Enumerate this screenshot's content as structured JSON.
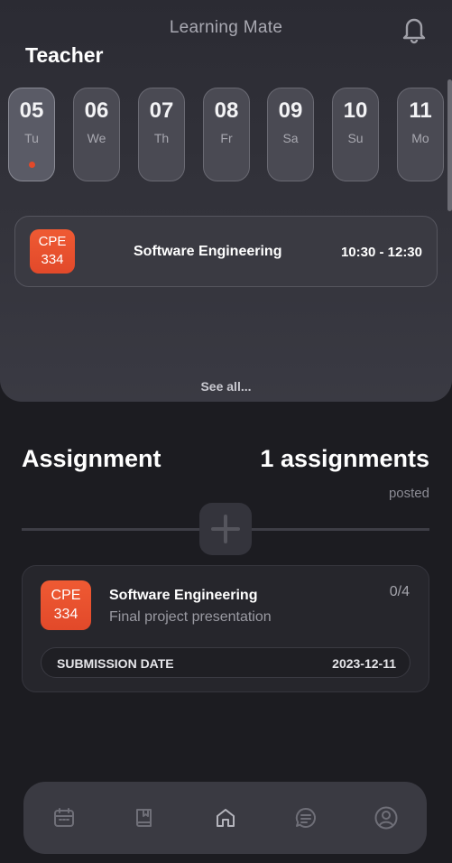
{
  "app": {
    "title": "Learning Mate",
    "role": "Teacher"
  },
  "calendar": {
    "days": [
      {
        "num": "05",
        "name": "Tu",
        "active": true
      },
      {
        "num": "06",
        "name": "We"
      },
      {
        "num": "07",
        "name": "Th"
      },
      {
        "num": "08",
        "name": "Fr"
      },
      {
        "num": "09",
        "name": "Sa"
      },
      {
        "num": "10",
        "name": "Su"
      },
      {
        "num": "11",
        "name": "Mo"
      }
    ]
  },
  "schedule": {
    "items": [
      {
        "code_line1": "CPE",
        "code_line2": "334",
        "course": "Software Engineering",
        "time": "10:30 - 12:30"
      }
    ],
    "see_all": "See all..."
  },
  "assignments": {
    "title": "Assignment",
    "count": "1 assignments",
    "posted": "posted",
    "items": [
      {
        "code_line1": "CPE",
        "code_line2": "334",
        "course": "Software Engineering",
        "description": "Final project presentation",
        "progress": "0/4",
        "submission_label": "SUBMISSION DATE",
        "submission_date": "2023-12-11"
      }
    ]
  },
  "nav": {
    "items": [
      {
        "icon": "calendar-icon"
      },
      {
        "icon": "book-icon"
      },
      {
        "icon": "home-icon",
        "active": true
      },
      {
        "icon": "chat-icon"
      },
      {
        "icon": "profile-icon"
      }
    ]
  },
  "colors": {
    "accent": "#e2492a",
    "background": "#1c1c21",
    "panel": "#33333b"
  }
}
